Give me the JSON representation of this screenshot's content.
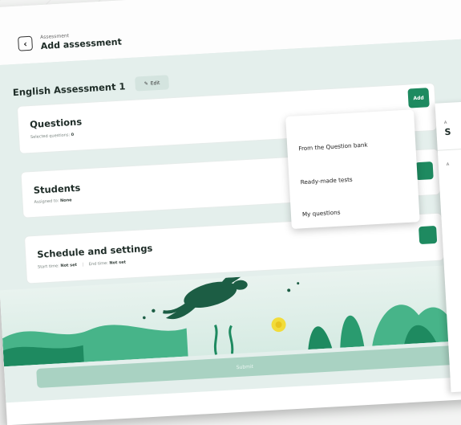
{
  "header": {
    "breadcrumb": "Assessment",
    "title": "Add assessment",
    "back_icon": "‹"
  },
  "assessment": {
    "name": "English Assessment 1",
    "edit_label": "Edit",
    "edit_icon": "✎"
  },
  "questions_card": {
    "title": "Questions",
    "subtitle_label": "Selected questions:",
    "subtitle_value": "0",
    "add_label": "Add"
  },
  "students_card": {
    "title": "Students",
    "subtitle_label": "Assigned to:",
    "subtitle_value": "None"
  },
  "schedule_card": {
    "title": "Schedule and settings",
    "start_label": "Start time:",
    "start_value": "Not set",
    "end_label": "End time:",
    "end_value": "Not set"
  },
  "add_menu": {
    "items": [
      "From the Question bank",
      "Ready-made tests",
      "My questions"
    ]
  },
  "submit": {
    "label": "Submit"
  },
  "side_panel": {
    "breadcrumb": "A",
    "title": "S",
    "label": "A"
  },
  "colors": {
    "accent": "#1e8a60",
    "band": "#e4efec",
    "submit_disabled": "#a9d2c2"
  }
}
